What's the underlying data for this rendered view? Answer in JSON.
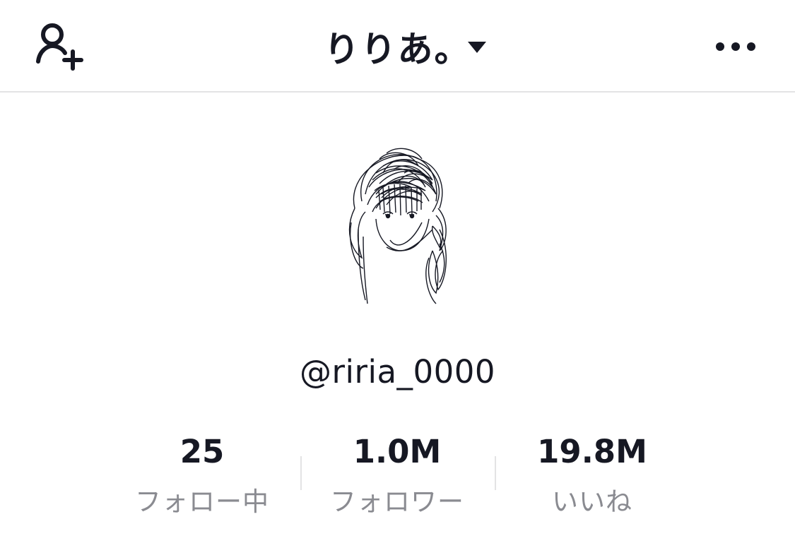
{
  "header": {
    "title": "りりあ。",
    "add_friend_icon": "person-plus-icon",
    "dropdown_icon": "caret-down-icon",
    "more_icon": "more-horizontal-icon"
  },
  "profile": {
    "avatar": "sketch-avatar",
    "username": "@riria_0000"
  },
  "stats": [
    {
      "value": "25",
      "label": "フォロー中"
    },
    {
      "value": "1.0M",
      "label": "フォロワー"
    },
    {
      "value": "19.8M",
      "label": "いいね"
    }
  ],
  "colors": {
    "text": "#161823",
    "secondary": "#8a8b91",
    "divider": "#e3e3e4",
    "background": "#ffffff"
  }
}
